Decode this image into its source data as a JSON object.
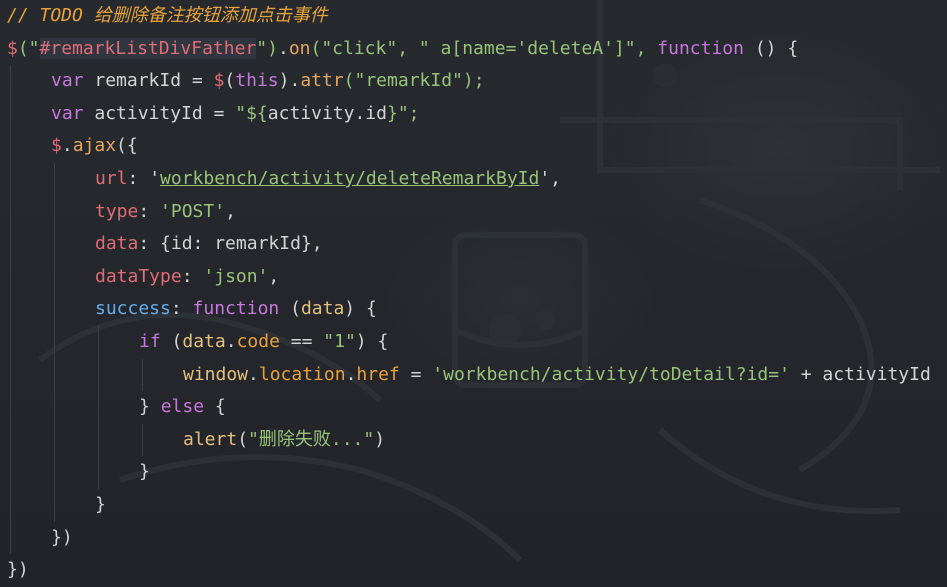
{
  "editor": {
    "theme_colors": {
      "background": "#25272b",
      "comment": "#e8a23a",
      "keyword": "#c678dd",
      "string": "#98c379",
      "identifier": "#d4d4d4",
      "dollar": "#e06c75"
    },
    "lines": [
      {
        "indent": 0,
        "tokens": [
          {
            "t": "// TODO 给删除备注按钮添加点击事件",
            "k": "comment"
          }
        ]
      },
      {
        "indent": 0,
        "tokens": [
          {
            "t": "$",
            "k": "dollar"
          },
          {
            "t": "(\"",
            "k": "string"
          },
          {
            "t": "#remarkListDivFather",
            "k": "sel"
          },
          {
            "t": "\")",
            "k": "string"
          },
          {
            "t": ".",
            "k": "ident"
          },
          {
            "t": "on",
            "k": "method"
          },
          {
            "t": "(\"click\", \" a[name='deleteA']\", ",
            "k": "string"
          },
          {
            "t": "function",
            "k": "keyword"
          },
          {
            "t": " () {",
            "k": "ident"
          }
        ]
      },
      {
        "indent": 1,
        "tokens": [
          {
            "t": "var ",
            "k": "keyword"
          },
          {
            "t": "remarkId = ",
            "k": "ident"
          },
          {
            "t": "$",
            "k": "dollar"
          },
          {
            "t": "(",
            "k": "ident"
          },
          {
            "t": "this",
            "k": "this"
          },
          {
            "t": ").",
            "k": "ident"
          },
          {
            "t": "attr",
            "k": "method"
          },
          {
            "t": "(\"remarkId\");",
            "k": "string"
          }
        ]
      },
      {
        "indent": 1,
        "tokens": [
          {
            "t": "var ",
            "k": "keyword"
          },
          {
            "t": "activityId = ",
            "k": "ident"
          },
          {
            "t": "\"${",
            "k": "string"
          },
          {
            "t": "activity.id",
            "k": "ident"
          },
          {
            "t": "}\";",
            "k": "string"
          }
        ]
      },
      {
        "indent": 1,
        "tokens": [
          {
            "t": "$",
            "k": "dollar"
          },
          {
            "t": ".",
            "k": "ident"
          },
          {
            "t": "ajax",
            "k": "method"
          },
          {
            "t": "({",
            "k": "ident"
          }
        ]
      },
      {
        "indent": 2,
        "tokens": [
          {
            "t": "url",
            "k": "objkey"
          },
          {
            "t": ": '",
            "k": "ident"
          },
          {
            "t": "workbench/activity/deleteRemarkById",
            "k": "url"
          },
          {
            "t": "',",
            "k": "ident"
          }
        ]
      },
      {
        "indent": 2,
        "tokens": [
          {
            "t": "type",
            "k": "objkey"
          },
          {
            "t": ": ",
            "k": "ident"
          },
          {
            "t": "'POST'",
            "k": "string"
          },
          {
            "t": ",",
            "k": "ident"
          }
        ]
      },
      {
        "indent": 2,
        "tokens": [
          {
            "t": "data",
            "k": "objkey"
          },
          {
            "t": ": {id: remarkId},",
            "k": "ident"
          }
        ]
      },
      {
        "indent": 2,
        "tokens": [
          {
            "t": "dataType",
            "k": "objkey"
          },
          {
            "t": ": ",
            "k": "ident"
          },
          {
            "t": "'json'",
            "k": "string"
          },
          {
            "t": ",",
            "k": "ident"
          }
        ]
      },
      {
        "indent": 2,
        "tokens": [
          {
            "t": "success",
            "k": "blue"
          },
          {
            "t": ": ",
            "k": "ident"
          },
          {
            "t": "function",
            "k": "keyword"
          },
          {
            "t": " (",
            "k": "ident"
          },
          {
            "t": "data",
            "k": "yellow"
          },
          {
            "t": ") {",
            "k": "ident"
          }
        ]
      },
      {
        "indent": 3,
        "tokens": [
          {
            "t": "if ",
            "k": "keyword"
          },
          {
            "t": "(",
            "k": "ident"
          },
          {
            "t": "data",
            "k": "yellow"
          },
          {
            "t": ".",
            "k": "ident"
          },
          {
            "t": "code",
            "k": "prop"
          },
          {
            "t": " == ",
            "k": "ident"
          },
          {
            "t": "\"1\"",
            "k": "string"
          },
          {
            "t": ") {",
            "k": "ident"
          }
        ]
      },
      {
        "indent": 4,
        "tokens": [
          {
            "t": "window",
            "k": "yellow"
          },
          {
            "t": ".",
            "k": "ident"
          },
          {
            "t": "location",
            "k": "prop"
          },
          {
            "t": ".",
            "k": "ident"
          },
          {
            "t": "href",
            "k": "prop"
          },
          {
            "t": " = ",
            "k": "ident"
          },
          {
            "t": "'workbench/activity/toDetail?id='",
            "k": "string"
          },
          {
            "t": " + activityId",
            "k": "ident"
          }
        ]
      },
      {
        "indent": 3,
        "tokens": [
          {
            "t": "} ",
            "k": "ident"
          },
          {
            "t": "else",
            "k": "keyword"
          },
          {
            "t": " {",
            "k": "ident"
          }
        ]
      },
      {
        "indent": 4,
        "tokens": [
          {
            "t": "alert",
            "k": "yellow"
          },
          {
            "t": "(",
            "k": "ident"
          },
          {
            "t": "\"删除失败...\"",
            "k": "string"
          },
          {
            "t": ")",
            "k": "ident"
          }
        ]
      },
      {
        "indent": 3,
        "tokens": [
          {
            "t": "}",
            "k": "ident"
          }
        ]
      },
      {
        "indent": 2,
        "tokens": [
          {
            "t": "}",
            "k": "ident"
          }
        ]
      },
      {
        "indent": 1,
        "tokens": [
          {
            "t": "})",
            "k": "ident"
          }
        ]
      },
      {
        "indent": 0,
        "tokens": [
          {
            "t": "})",
            "k": "ident"
          }
        ]
      }
    ]
  }
}
